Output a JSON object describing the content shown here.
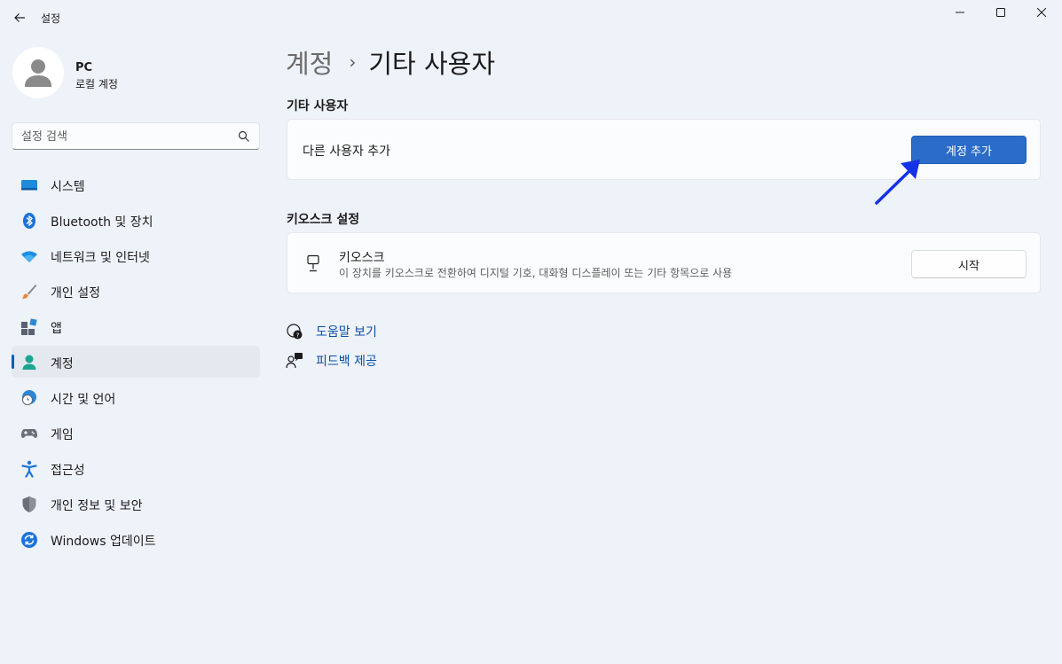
{
  "window": {
    "title": "설정",
    "controls": [
      "minimize-icon",
      "maximize-icon",
      "close-icon"
    ]
  },
  "user": {
    "name": "PC",
    "account_type": "로컬 계정"
  },
  "search": {
    "placeholder": "설정 검색",
    "value": ""
  },
  "sidebar": {
    "items": [
      {
        "label": "시스템",
        "icon": "system-icon",
        "active": false
      },
      {
        "label": "Bluetooth 및 장치",
        "icon": "bluetooth-icon",
        "active": false
      },
      {
        "label": "네트워크 및 인터넷",
        "icon": "wifi-icon",
        "active": false
      },
      {
        "label": "개인 설정",
        "icon": "brush-icon",
        "active": false
      },
      {
        "label": "앱",
        "icon": "apps-icon",
        "active": false
      },
      {
        "label": "계정",
        "icon": "account-icon",
        "active": true
      },
      {
        "label": "시간 및 언어",
        "icon": "clock-globe-icon",
        "active": false
      },
      {
        "label": "게임",
        "icon": "gamepad-icon",
        "active": false
      },
      {
        "label": "접근성",
        "icon": "accessibility-icon",
        "active": false
      },
      {
        "label": "개인 정보 및 보안",
        "icon": "shield-icon",
        "active": false
      },
      {
        "label": "Windows 업데이트",
        "icon": "update-icon",
        "active": false
      }
    ]
  },
  "breadcrumb": {
    "parent": "계정",
    "separator": "›",
    "current": "기타 사용자"
  },
  "other_users": {
    "section_title": "기타 사용자",
    "add_label": "다른 사용자 추가",
    "add_button": "계정 추가"
  },
  "kiosk": {
    "section_title": "키오스크 설정",
    "title": "키오스크",
    "description": "이 장치를 키오스크로 전환하여 디지털 기호, 대화형 디스플레이 또는 기타 항목으로 사용",
    "start_button": "시작"
  },
  "links": {
    "help": "도움말 보기",
    "feedback": "피드백 제공"
  },
  "colors": {
    "accent": "#2a6cc7",
    "background": "#eef2f9",
    "card": "#fbfcfd",
    "annotation_arrow": "#1432e6"
  }
}
